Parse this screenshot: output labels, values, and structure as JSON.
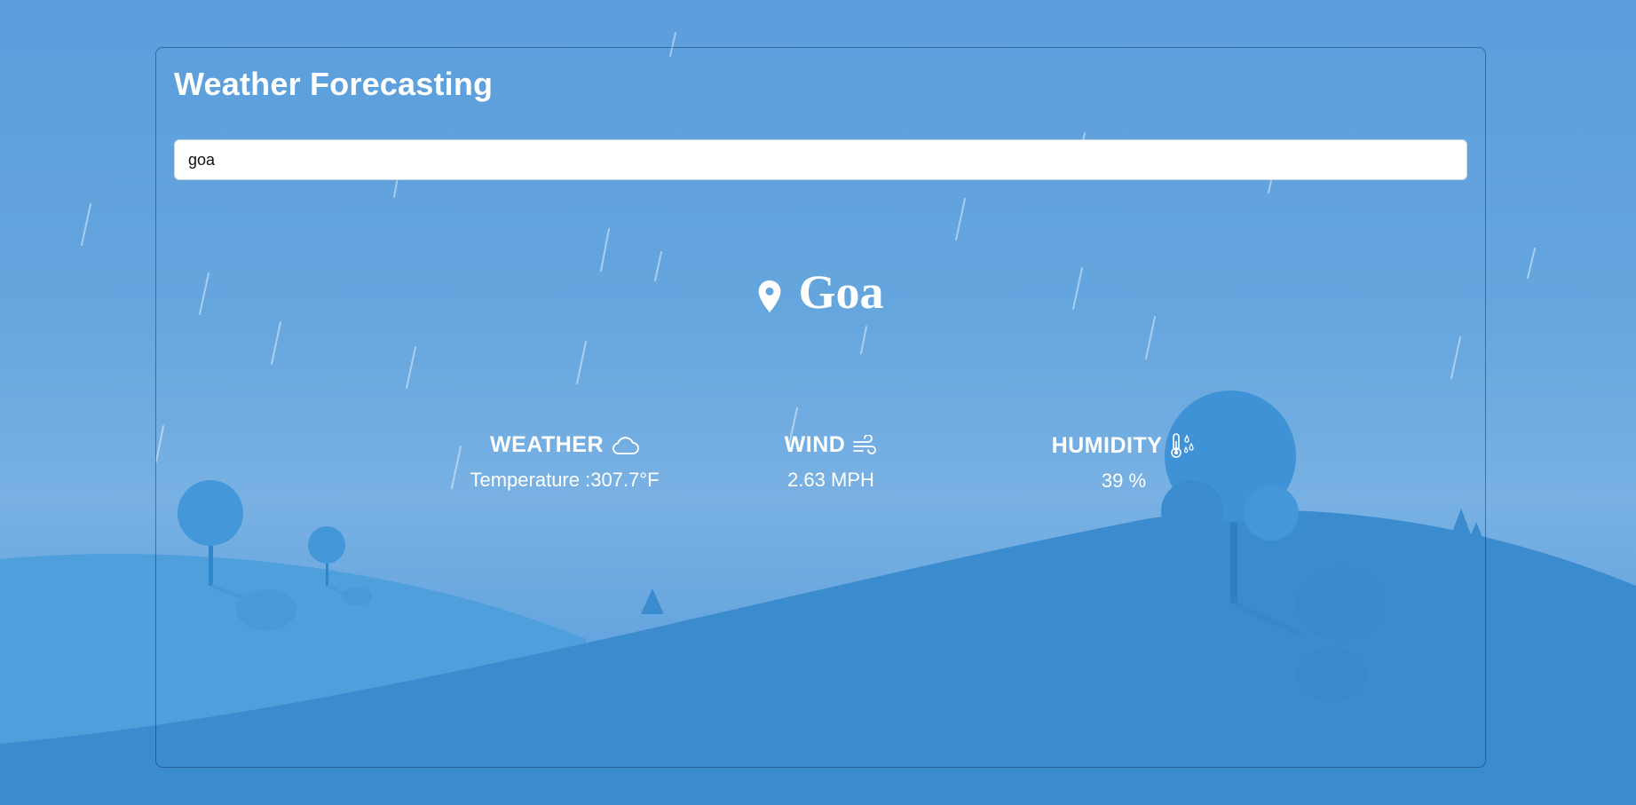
{
  "app": {
    "title": "Weather Forecasting"
  },
  "search": {
    "value": "goa",
    "icon": "search-input"
  },
  "location": {
    "city": "Goa",
    "icon": "map-pin-icon"
  },
  "stats": {
    "weather": {
      "label": "WEATHER",
      "value": "Temperature :307.7°F",
      "icon": "cloud-icon"
    },
    "wind": {
      "label": "WIND",
      "value": "2.63 MPH",
      "icon": "wind-icon"
    },
    "humidity": {
      "label": "HUMIDITY",
      "value": "39 %",
      "icon": "thermometer-droplets-icon"
    }
  },
  "colors": {
    "sky_top": "#5b9edb",
    "hill_front": "#3b8ccf",
    "hill_back": "#509fdd",
    "text": "#ffffff"
  }
}
